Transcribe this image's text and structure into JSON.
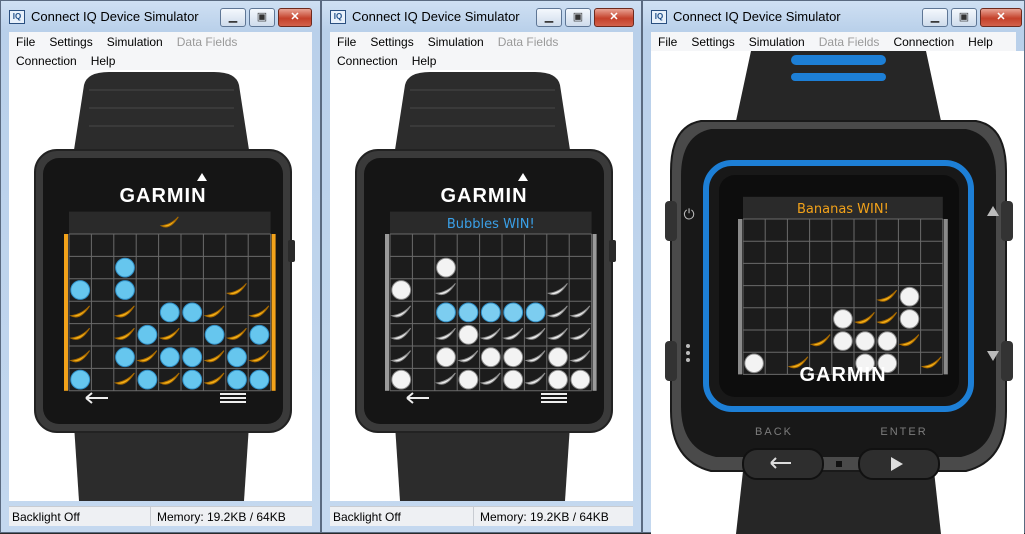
{
  "windows": [
    {
      "title": "Connect IQ Device Simulator",
      "icon": "IQ",
      "menu_rows": [
        [
          "File",
          "Settings",
          "Simulation",
          "Data Fields"
        ],
        [
          "Connection",
          "Help"
        ]
      ],
      "disabled_menu": [
        "Data Fields"
      ],
      "status": {
        "backlight": "Backlight Off",
        "memory": "Memory: 19.2KB / 64KB"
      },
      "device": {
        "model": "vivoactive",
        "brand": "GARMIN",
        "message": "",
        "indicator": "banana-icon",
        "message_color": "#3aa0e8",
        "side_bar_color": "#f2a21a",
        "icons": [
          "back-arrow-icon",
          "menu-icon",
          "banana-icon",
          "bubble-icon"
        ],
        "mode": "color",
        "board": [
          ".........",
          "..B......",
          "B.B....A.",
          "A.A.BBA.A",
          "A.ABA.BAB",
          "A.BABBABA",
          "B.ABABABB"
        ]
      }
    },
    {
      "title": "Connect IQ Device Simulator",
      "icon": "IQ",
      "menu_rows": [
        [
          "File",
          "Settings",
          "Simulation",
          "Data Fields"
        ],
        [
          "Connection",
          "Help"
        ]
      ],
      "disabled_menu": [
        "Data Fields"
      ],
      "status": {
        "backlight": "Backlight Off",
        "memory": "Memory: 19.2KB / 64KB"
      },
      "device": {
        "model": "vivoactive",
        "brand": "GARMIN",
        "message": "Bubbles WIN!",
        "indicator": "",
        "message_color": "#3aa0e8",
        "side_bar_color": "#9a9a9a",
        "icons": [
          "back-arrow-icon",
          "menu-icon",
          "banana-icon",
          "bubble-icon"
        ],
        "mode": "win",
        "board": [
          ".........",
          "..B......",
          "B.A....A.",
          "A.BBBBBAA",
          "A.ABAAAAA",
          "A.BABBABA",
          "B.ABABABB"
        ]
      }
    },
    {
      "title": "Connect IQ Device Simulator",
      "icon": "IQ",
      "menu_rows": [
        [
          "File",
          "Settings",
          "Simulation",
          "Data Fields",
          "Connection",
          "Help"
        ]
      ],
      "disabled_menu": [
        "Data Fields"
      ],
      "status": null,
      "device": {
        "model": "forerunner 920xt",
        "brand": "GARMIN",
        "message": "Bananas WIN!",
        "indicator": "",
        "message_color": "#f2a21a",
        "side_bar_color": "#8a8a8a",
        "buttons": [
          "BACK",
          "ENTER"
        ],
        "icons": [
          "power-icon",
          "dots-icon",
          "up-arrow-icon",
          "down-arrow-icon",
          "back-button-icon",
          "play-icon"
        ],
        "mode": "win",
        "board": [
          ".........",
          ".........",
          ".........",
          "......AB.",
          "....BAAB.",
          "...ABBBA.",
          "B.A..BB.A"
        ]
      }
    }
  ]
}
